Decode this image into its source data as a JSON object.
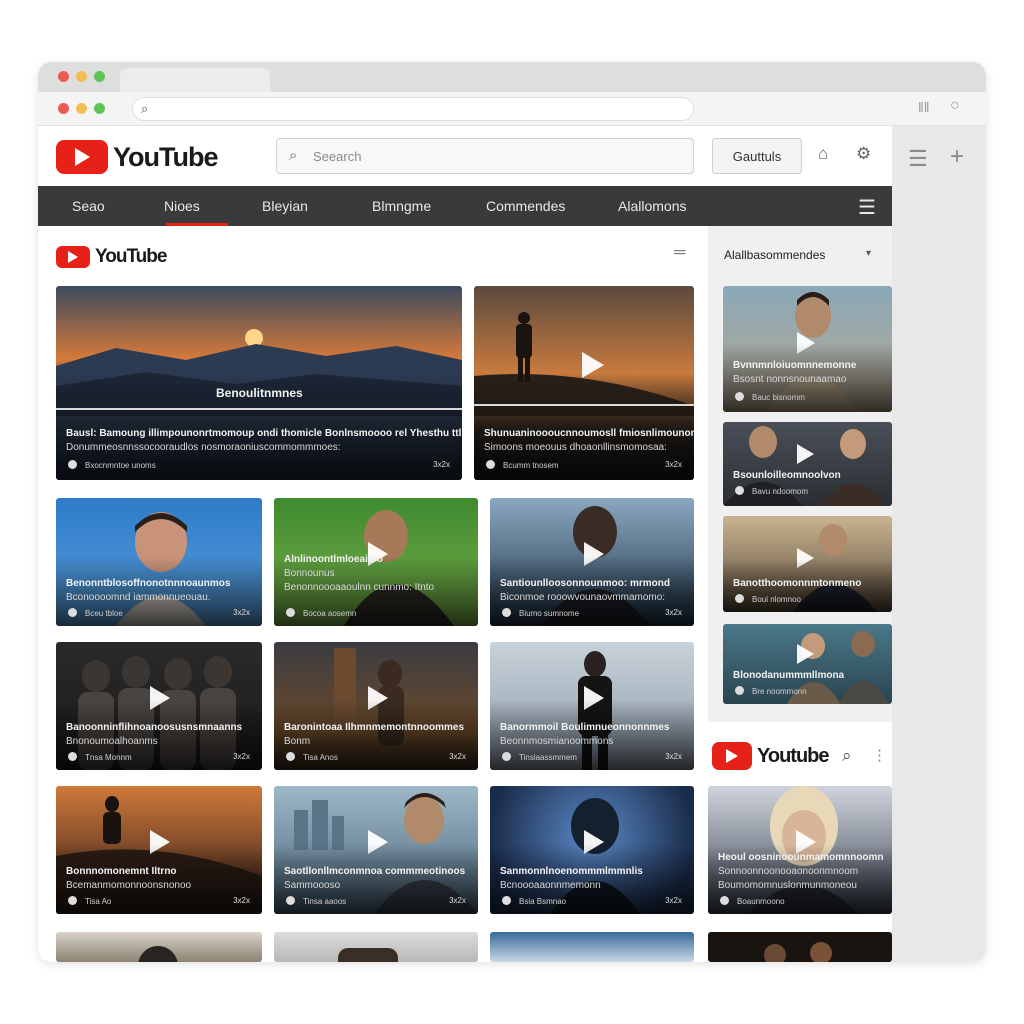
{
  "browser": {
    "title": "",
    "url": ""
  },
  "header": {
    "logo_text": "YouTube",
    "search_placeholder": "Seearch",
    "button_label": "Gauttuls"
  },
  "nav": {
    "items": [
      "Seao",
      "Nioes",
      "Bleyian",
      "Blmngme",
      "Commendes",
      "Alallomons"
    ],
    "active_index": 1
  },
  "sub_logo_text": "YouTube",
  "featured": [
    {
      "overlay_label": "Benoulitnmnes",
      "title": "Bausl: Bamoung illimpounonrtmomoup ondi thomicle Bonlnsmoooo rel Yhesthu ttlu",
      "line2": "Donummeosnnssocooraudlos nosmoraoniuscommommmoes:",
      "channel": "Bxocnmntoe unoms",
      "duration": "3x2x"
    },
    {
      "title": "Shunuaninoooucnnoumosll fmiosnlimounonnnoo",
      "line2": "Simoons moeouus dhoaonllinsmomosaa:",
      "channel": "Bcumm tnosem",
      "duration": "3x2x"
    }
  ],
  "grid": [
    {
      "title": "Benonntblosoffnonotnnnoaunmos",
      "line2": "Bconoooomnd iammonnueouau.",
      "channel": "Bceu tbloe",
      "duration": "3x2x"
    },
    {
      "title": "Alnlinoontlmloeaiioo",
      "line2": "Bonnounus",
      "line3": "Benonnoooaaoulnn cunnmo: Itnto",
      "channel": "Bocoa aosemn",
      "duration": ""
    },
    {
      "title": "Santiounlloosonnounmoo: mrmond",
      "line2": "Biconmoe rooowvounaovmmamomo:",
      "channel": "Biumo sumnome",
      "duration": "3x2x"
    },
    {
      "title": "Banoonninflihnoanoosusnsmnaanns",
      "line2": "Bnonoumoalhoanms",
      "channel": "Tnsa Monnm",
      "duration": "3x2x"
    },
    {
      "title": "Baronintoaa Ilhmnmemontnnoommes",
      "line2": "Bonm",
      "channel": "Tisa Anos",
      "duration": "3x2x"
    },
    {
      "title": "Banormmoil Boulimnueonnonnmes",
      "line2": "Beonnmosmianoommons",
      "channel": "Tinsiaassmmem",
      "duration": "3x2x"
    },
    {
      "title": "Bonnnomonemnt Iltrno",
      "line2": "Bcemanmomonnoonsnonoo",
      "channel": "Tisa Ao",
      "duration": "3x2x"
    },
    {
      "title": "Saotllonllmconmnoa commmeotinoos",
      "line2": "Sammoooso",
      "channel": "Tinsa aaoos",
      "duration": "3x2x"
    },
    {
      "title": "Sanmonnlnoenommmlmmnlis",
      "line2": "Bcnoooaaonnmemonn",
      "channel": "Bsia Bsmnao",
      "duration": "3x2x"
    }
  ],
  "recommended": {
    "title": "Alallbasommendes",
    "items": [
      {
        "title": "Bvnnmnloiuomnnemonne",
        "line2": "Bsosnt nonnsnounaamao",
        "channel": "Bauc bisnomm"
      },
      {
        "title": "Bsounloilleomnoolvon",
        "line2": "Bavu ndoomom"
      },
      {
        "title": "Banotthoomonnmtonmeno",
        "channel": "Boui nlomnoo"
      },
      {
        "title": "Blonodanummmllmona",
        "channel": "Bre noommonn"
      }
    ]
  },
  "mini_logo_text": "Youtube",
  "mini_card": {
    "title": "Heoul oosninoounmamomnnoomn",
    "line2": "Sonnoonnoonooaonoonmnoom",
    "line3": "Boumomomnuslonmunmoneou",
    "channel": "Boaunmoono"
  },
  "colors": {
    "brand_red": "#e62117",
    "nav_bg": "#3a3a3a",
    "page_bg": "#ffffff",
    "sidebar_bg": "#f0f0f0"
  },
  "icons": [
    "search-icon",
    "bell-icon",
    "settings-icon",
    "hamburger-menu-icon",
    "plus-icon",
    "play-icon",
    "chevron-down-icon"
  ]
}
